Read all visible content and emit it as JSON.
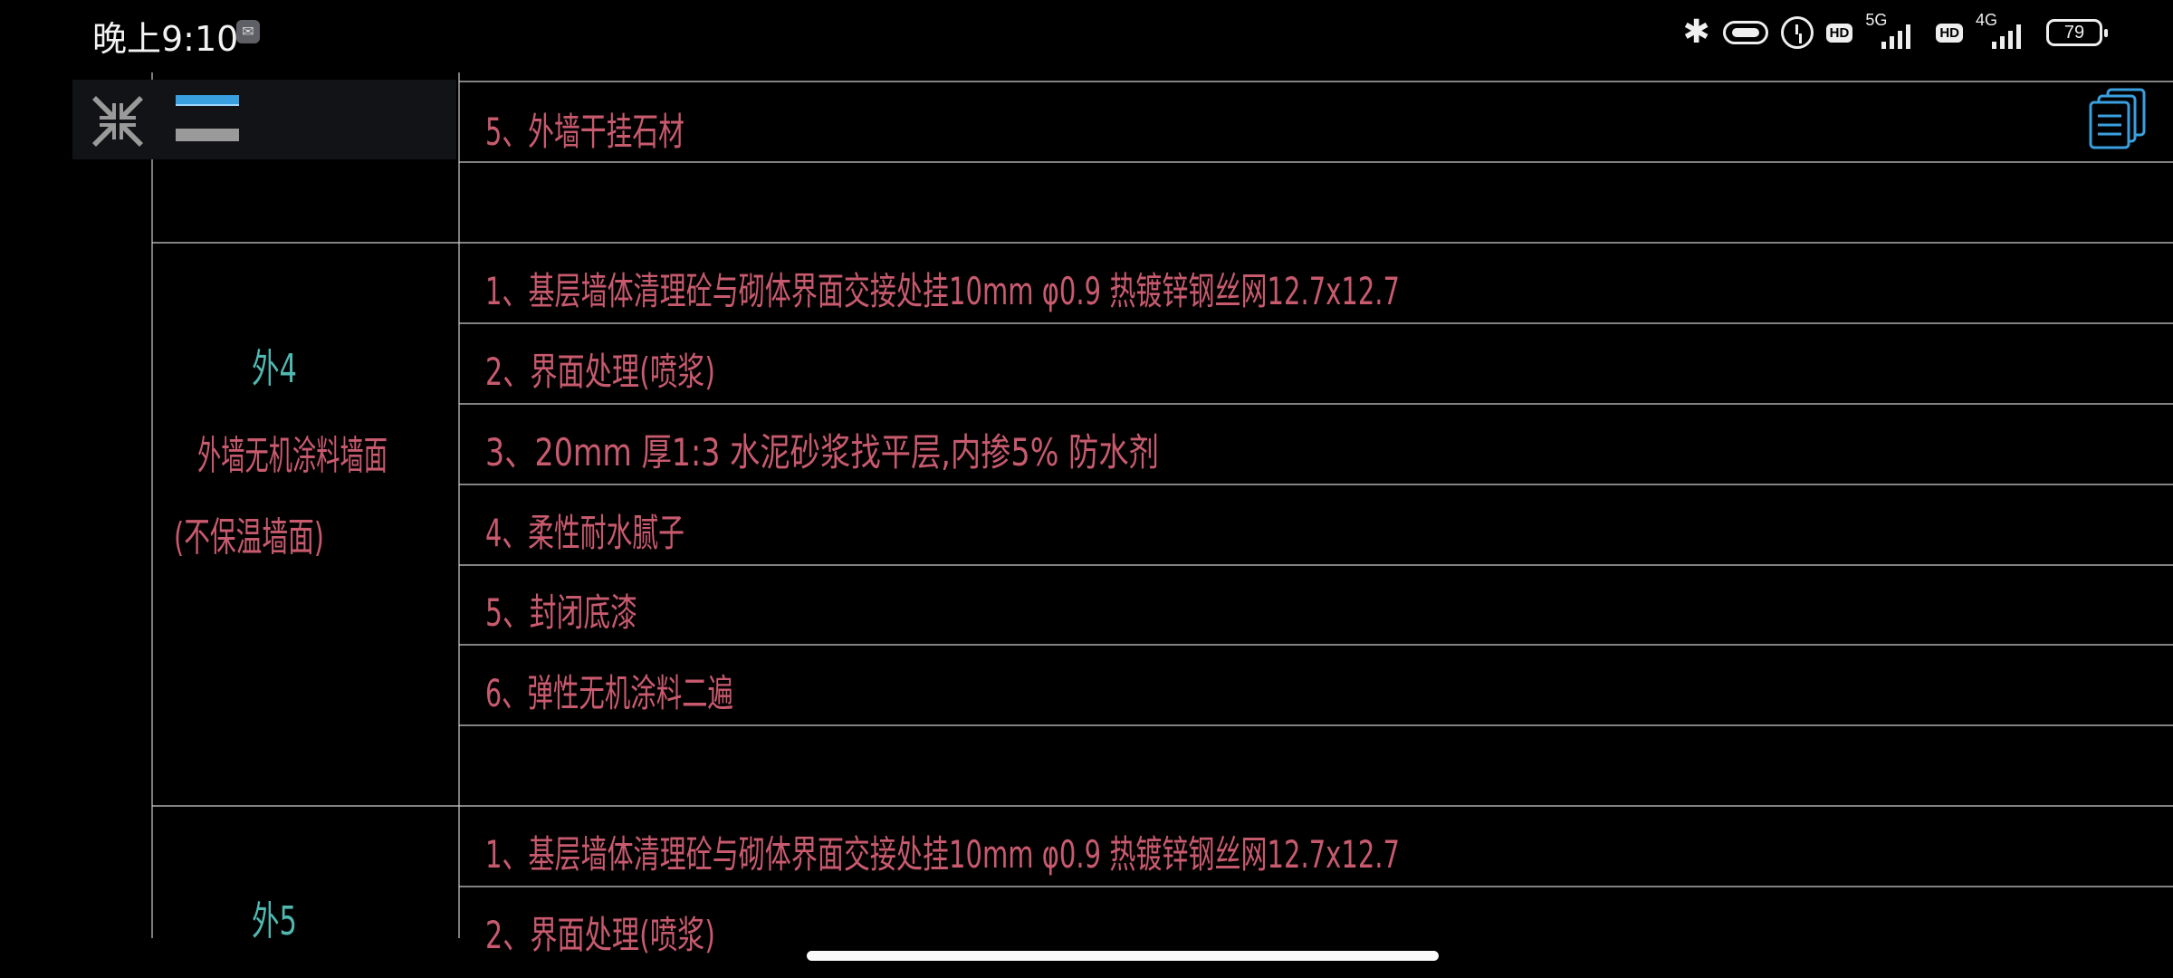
{
  "status_bar": {
    "time": "晚上9:10",
    "hd1": "HD",
    "net1": "5G",
    "hd2": "HD",
    "net2": "4G",
    "battery": "79",
    "icons": [
      "message-icon",
      "bluetooth-icon",
      "vibrate-icon",
      "alarm-icon",
      "signal-icon",
      "battery-icon"
    ]
  },
  "toolbar": {
    "icons": [
      "shrink-icon",
      "toolbar-line-blue",
      "toolbar-line-gray"
    ]
  },
  "layers_button": {
    "icon": "layers-icon"
  },
  "drawing": {
    "colors": {
      "line": "#d9d9d9",
      "item_text": "#c85a6e",
      "code_text": "#4fb8b0",
      "name_text": "#c85a6e"
    },
    "top_partial_row": "5、外墙干挂石材",
    "section4": {
      "code": "外4",
      "name_line1": "外墙无机涂料墙面",
      "name_line2": "(不保温墙面)",
      "items": [
        "1、基层墙体清理砼与砌体界面交接处挂10mm    φ0.9  热镀锌钢丝网12.7x12.7",
        "2、界面处理(喷浆)",
        "3、20mm     厚1:3    水泥砂浆找平层,内掺5% 防水剂",
        "4、柔性耐水腻子",
        "5、封闭底漆",
        "6、弹性无机涂料二遍"
      ]
    },
    "section5": {
      "code": "外5",
      "items": [
        "1、基层墙体清理砼与砌体界面交接处挂10mm    φ0.9  热镀锌钢丝网12.7x12.7",
        "2、界面处理(喷浆)"
      ]
    }
  }
}
